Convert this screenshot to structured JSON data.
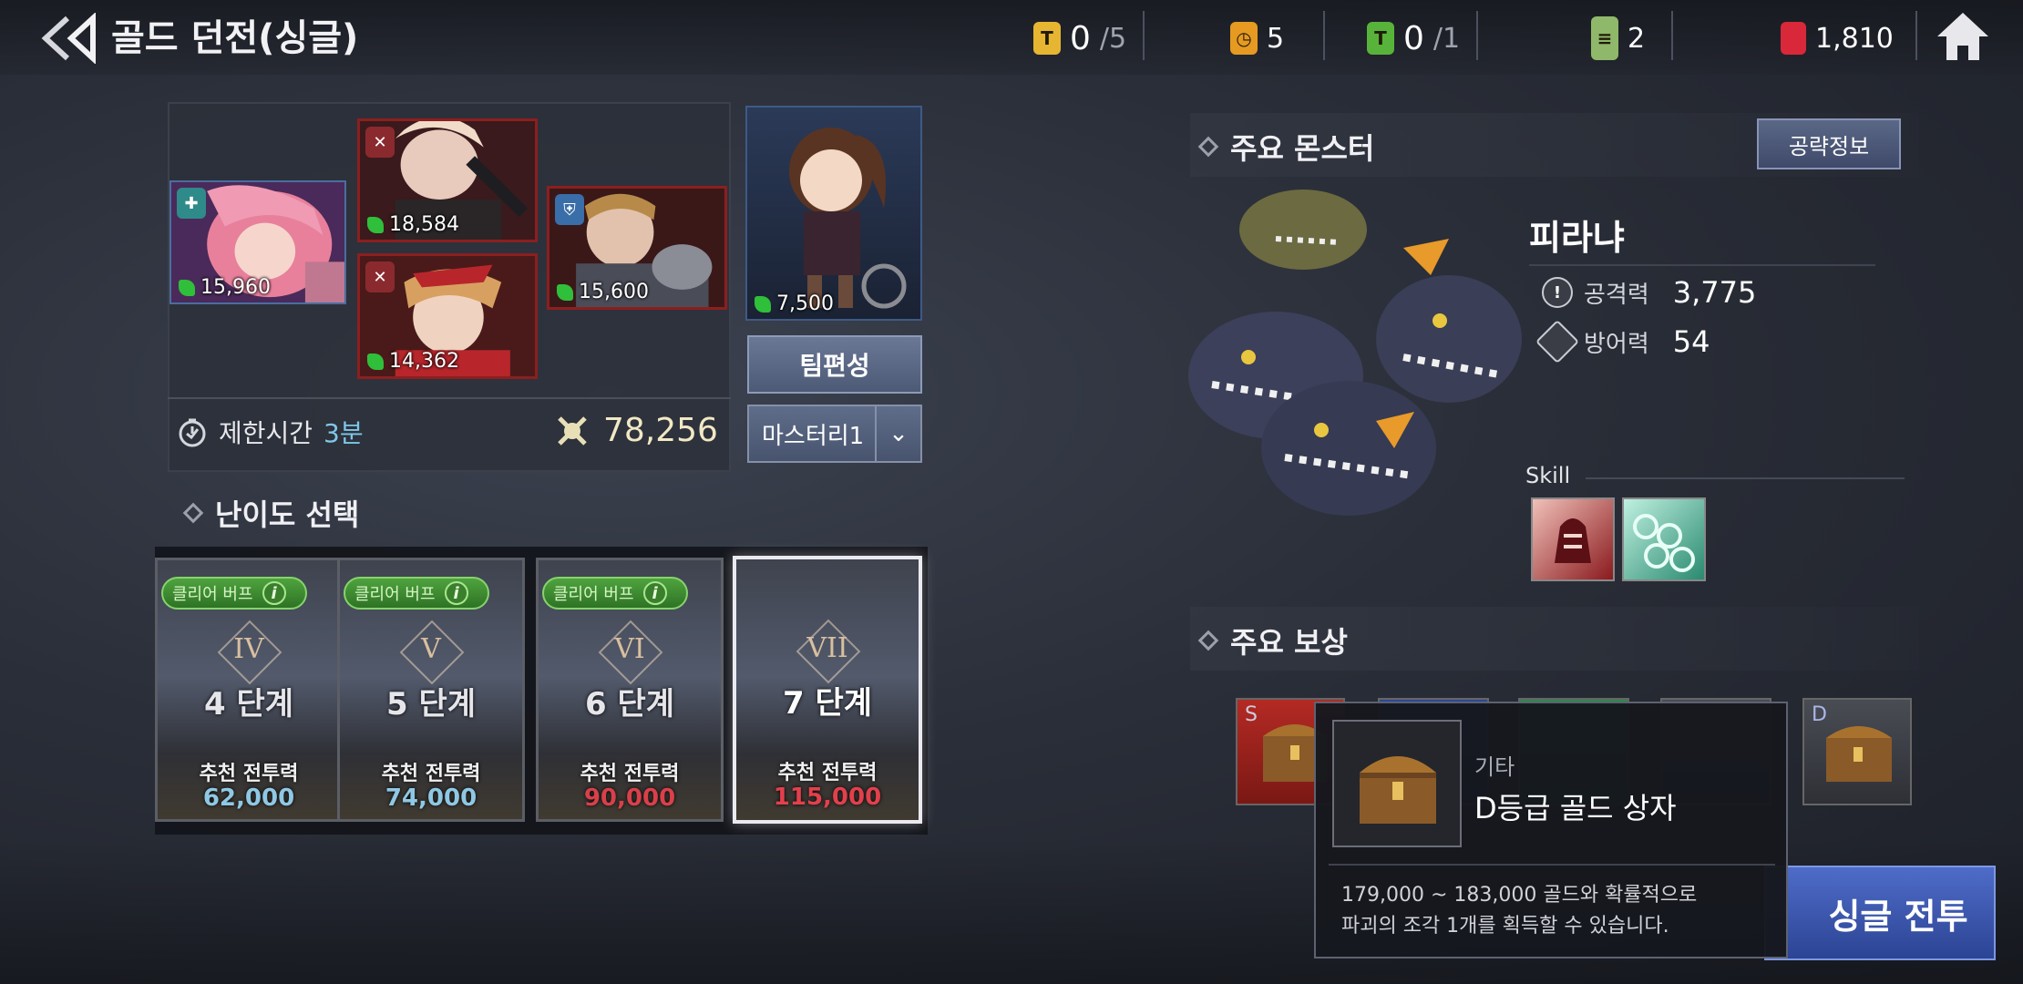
{
  "header": {
    "title": "골드 던전(싱글)",
    "currencies": [
      {
        "name": "ticket-t-gold",
        "value": "0",
        "max": "/5",
        "color": "#e6b532"
      },
      {
        "name": "stamina",
        "value": "5",
        "max": "",
        "color": "#e69a22"
      },
      {
        "name": "ticket-t-green",
        "value": "0",
        "max": "/1",
        "color": "#58b33a"
      },
      {
        "name": "scroll",
        "value": "2",
        "max": "",
        "color": "#8fb86a"
      },
      {
        "name": "ruby",
        "value": "1,810",
        "max": "",
        "color": "#d8283a"
      }
    ]
  },
  "party": {
    "heroes": [
      {
        "power": "15,960"
      },
      {
        "power": "18,584"
      },
      {
        "power": "14,362"
      },
      {
        "power": "15,600"
      }
    ],
    "leader_power": "7,500",
    "team_button": "팀편성",
    "mastery": "마스터리1",
    "time_label": "제한시간",
    "time_value": "3분",
    "total_power": "78,256"
  },
  "difficulty": {
    "header": "난이도 선택",
    "buff_label": "클리어 버프",
    "cards": [
      {
        "roman": "IV",
        "step": "4 단계",
        "rec_label": "추천 전투력",
        "rec_value": "62,000",
        "rec_color": "#8fc8e4"
      },
      {
        "roman": "V",
        "step": "5 단계",
        "rec_label": "추천 전투력",
        "rec_value": "74,000",
        "rec_color": "#8fc8e4"
      },
      {
        "roman": "VI",
        "step": "6 단계",
        "rec_label": "추천 전투력",
        "rec_value": "90,000",
        "rec_color": "#d9404a"
      },
      {
        "roman": "VII",
        "step": "7 단계",
        "rec_label": "추천 전투력",
        "rec_value": "115,000",
        "rec_color": "#e2404c"
      }
    ]
  },
  "monster": {
    "header": "주요 몬스터",
    "strategy_button": "공략정보",
    "name": "피라냐",
    "attack_label": "공격력",
    "attack_value": "3,775",
    "defense_label": "방어력",
    "defense_value": "54",
    "skill_label": "Skill"
  },
  "rewards": {
    "header": "주요 보상",
    "first_grade": "S",
    "last_grade": "D"
  },
  "tooltip": {
    "category": "기타",
    "name": "D등급 골드 상자",
    "description": "179,000 ~ 183,000 골드와 확률적으로\n파괴의 조각 1개를 획득할 수 있습니다."
  },
  "battle_button": "싱글 전투"
}
